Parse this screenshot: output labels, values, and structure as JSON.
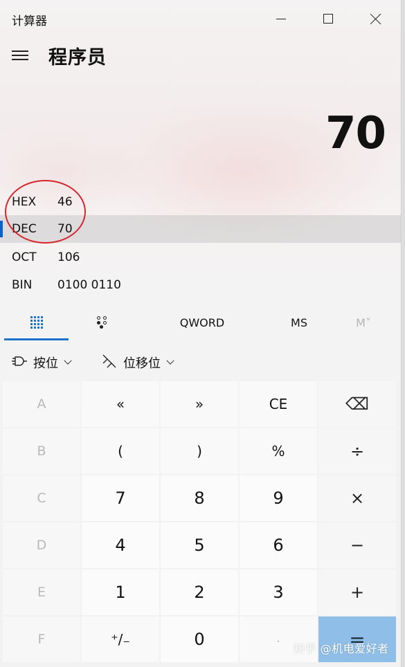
{
  "window": {
    "title": "计算器",
    "controls": {
      "minimize": "minimize",
      "maximize": "maximize",
      "close": "close"
    }
  },
  "header": {
    "mode_title": "程序员",
    "menu_icon": "hamburger-icon"
  },
  "display": {
    "value": "70"
  },
  "radix": [
    {
      "label": "HEX",
      "value": "46"
    },
    {
      "label": "DEC",
      "value": "70"
    },
    {
      "label": "OCT",
      "value": "106"
    },
    {
      "label": "BIN",
      "value": "0100 0110"
    }
  ],
  "active_radix": "DEC",
  "tabs": {
    "keypad_icon": "full-keypad-icon",
    "bits_icon": "bit-toggle-keypad-icon",
    "word_size": "QWORD",
    "memory_store": "MS",
    "memory_list": "M˅"
  },
  "dropdowns": {
    "bitwise": "按位",
    "bitshift": "位移位"
  },
  "keys": {
    "r1": [
      "A",
      "«",
      "»",
      "CE",
      "⌫"
    ],
    "r2": [
      "B",
      "(",
      ")",
      "%",
      "÷"
    ],
    "r3": [
      "C",
      "7",
      "8",
      "9",
      "×"
    ],
    "r4": [
      "D",
      "4",
      "5",
      "6",
      "−"
    ],
    "r5": [
      "E",
      "1",
      "2",
      "3",
      "+"
    ],
    "r6": [
      "F",
      "⁺/₋",
      "0",
      ".",
      "="
    ]
  },
  "watermark": "知乎 @机电爱好者",
  "colors": {
    "accent": "#0a64c8",
    "equals": "#8fbfe8",
    "annotation": "#d7252b"
  }
}
